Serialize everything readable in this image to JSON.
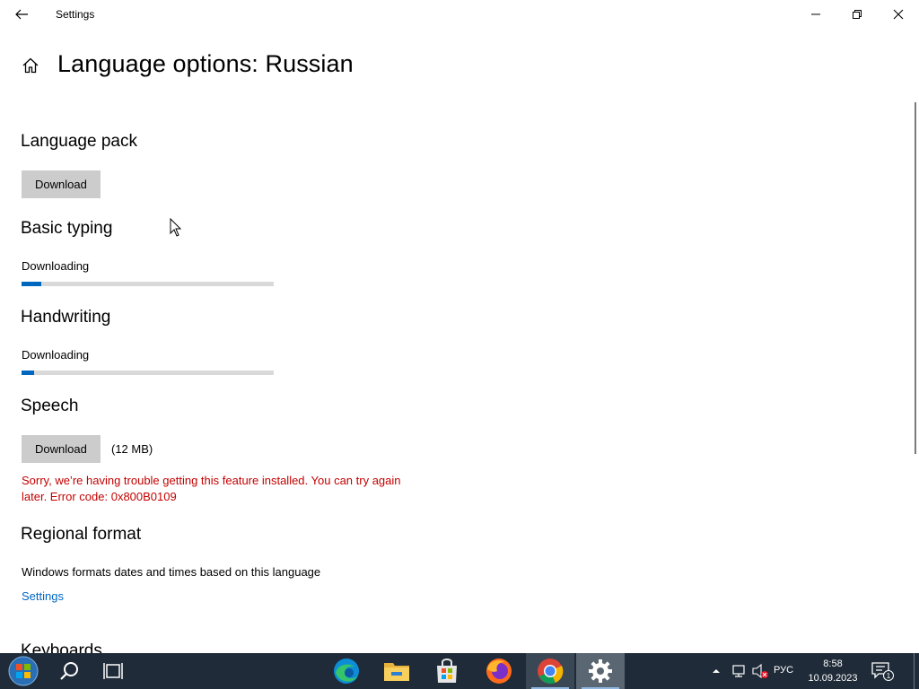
{
  "window": {
    "title": "Settings"
  },
  "page": {
    "title": "Language options: Russian"
  },
  "sections": {
    "language_pack": {
      "title": "Language pack",
      "button_label": "Download"
    },
    "basic_typing": {
      "title": "Basic typing",
      "status": "Downloading",
      "progress": 0.08
    },
    "handwriting": {
      "title": "Handwriting",
      "status": "Downloading",
      "progress": 0.05
    },
    "speech": {
      "title": "Speech",
      "button_label": "Download",
      "size": "(12 MB)",
      "error": "Sorry, we’re having trouble getting this feature installed. You can try again later. Error code: 0x800B0109"
    },
    "regional_format": {
      "title": "Regional format",
      "description": "Windows formats dates and times based on this language",
      "link": "Settings"
    },
    "keyboards": {
      "title": "Keyboards"
    }
  },
  "taskbar": {
    "language": "РУС",
    "time": "8:58",
    "date": "10.09.2023",
    "notification_count": "1",
    "apps": [
      "start-icon",
      "search-icon",
      "task-view-icon",
      "edge-icon",
      "file-explorer-icon",
      "store-icon",
      "firefox-icon",
      "chrome-icon",
      "settings-icon"
    ]
  },
  "colors": {
    "accent": "#0067c0",
    "error": "#c40000",
    "button": "#cccccc",
    "taskbar": "#1f2b38"
  }
}
